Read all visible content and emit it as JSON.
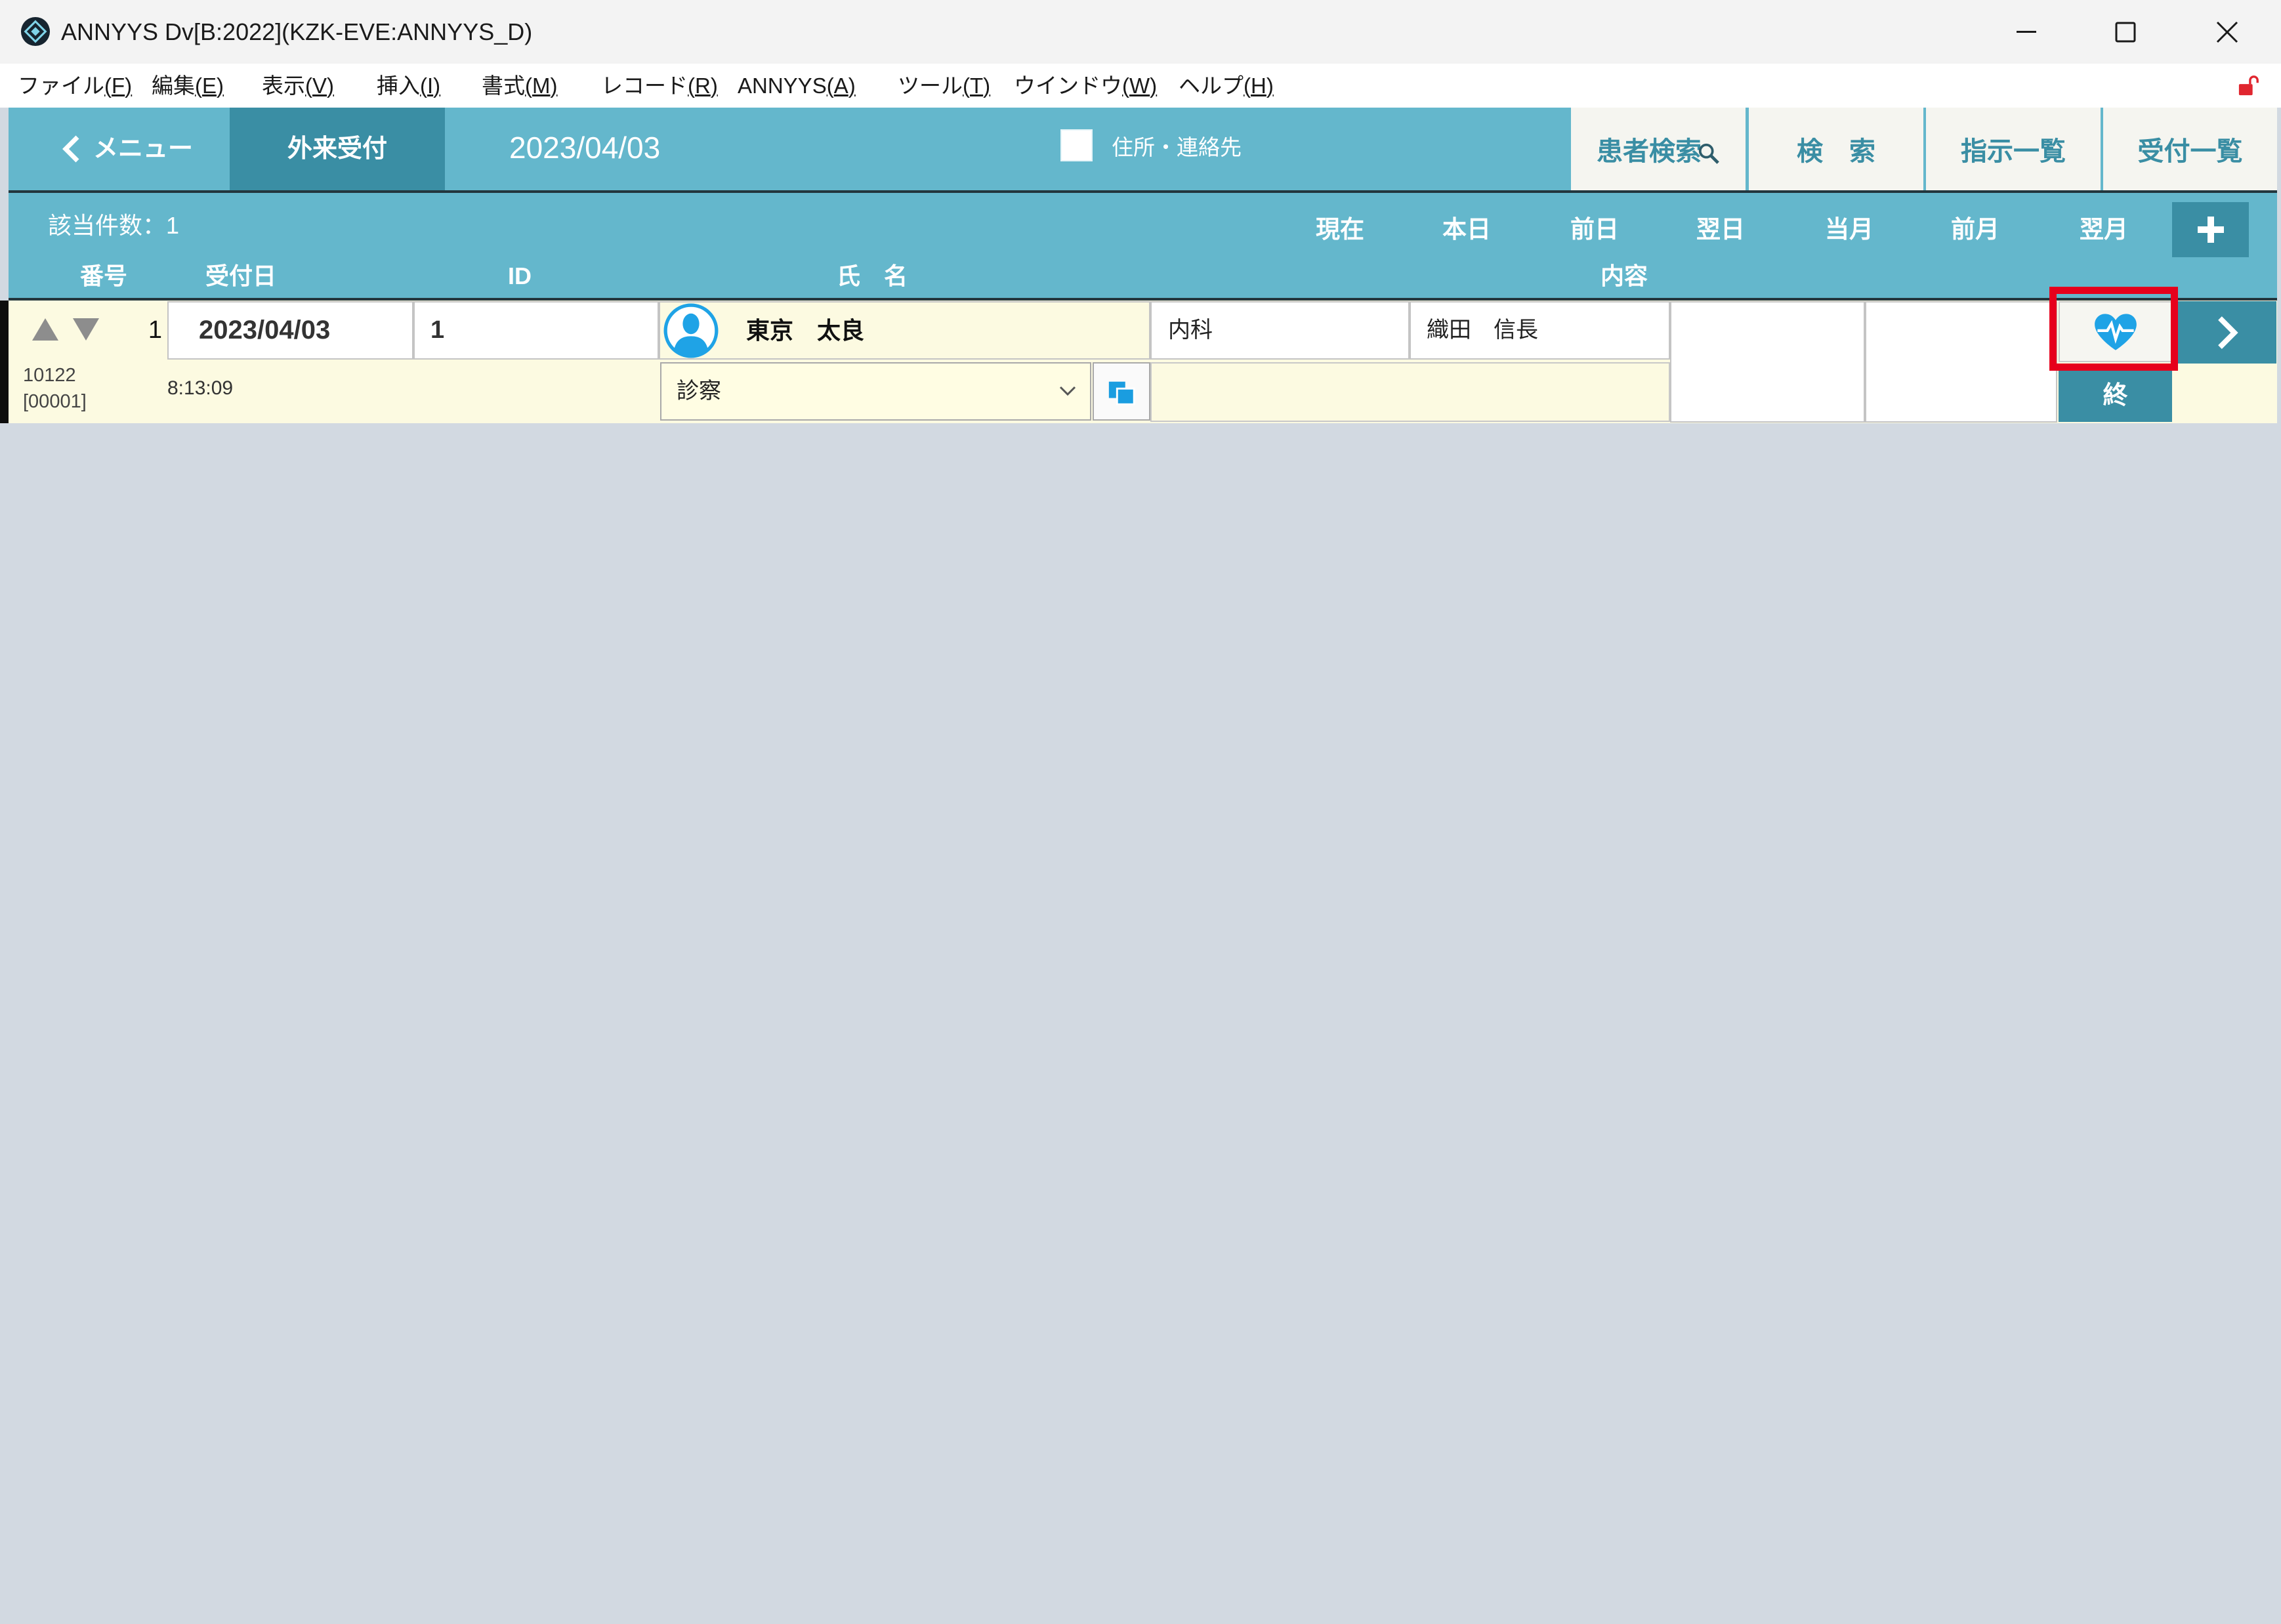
{
  "window": {
    "title": "ANNYYS Dv[B:2022](KZK-EVE:ANNYYS_D)"
  },
  "menu": [
    {
      "label": "ファイル",
      "key": "F"
    },
    {
      "label": "編集",
      "key": "E"
    },
    {
      "label": "表示",
      "key": "V"
    },
    {
      "label": "挿入",
      "key": "I"
    },
    {
      "label": "書式",
      "key": "M"
    },
    {
      "label": "レコード",
      "key": "R"
    },
    {
      "label": "ANNYYS",
      "key": "A"
    },
    {
      "label": "ツール",
      "key": "T"
    },
    {
      "label": "ウインドウ",
      "key": "W"
    },
    {
      "label": "ヘルプ",
      "key": "H"
    }
  ],
  "toolbar": {
    "back_label": "メニュー",
    "active_tab": "外来受付",
    "date": "2023/04/03",
    "address_option": {
      "label": "住所・連絡先",
      "checked": false
    },
    "buttons": [
      {
        "label": "患者検索"
      },
      {
        "label": "検　索"
      },
      {
        "label": "指示一覧"
      },
      {
        "label": "受付一覧"
      }
    ]
  },
  "filter": {
    "count_label": "該当件数：",
    "count": "1",
    "periods": [
      "現在",
      "本日",
      "前日",
      "翌日",
      "当月",
      "前月",
      "翌月"
    ]
  },
  "columns": [
    "番号",
    "受付日",
    "ID",
    "氏　名",
    "内容"
  ],
  "rows": [
    {
      "number": "1",
      "reception_no": "10122",
      "reception_sub_no": "[00001]",
      "date": "2023/04/03",
      "time": "8:13:09",
      "patient_id": "1",
      "name": "東京　太良",
      "department": "内科",
      "doctor": "織田　信長",
      "visit_type": "診察",
      "status": "終"
    }
  ],
  "icons": {
    "app": "app-logo-icon",
    "minimize": "minimize-icon",
    "maximize": "maximize-icon",
    "close": "close-icon",
    "lock": "unlock-icon",
    "back": "chevron-left-icon",
    "search": "search-icon",
    "add": "plus-icon",
    "sort_up": "triangle-up-icon",
    "sort_down": "triangle-down-icon",
    "avatar": "user-avatar-icon",
    "dropdown": "chevron-down-icon",
    "copy": "copy-icon",
    "vitals": "heart-pulse-icon",
    "next": "chevron-right-icon"
  },
  "colors": {
    "accent": "#64b7cc",
    "accent_dark": "#3a8ea4",
    "row_background": "#fcfae1",
    "workspace": "#d2d9e1",
    "highlight": "#e6001c",
    "icon_blue": "#1fa3e6"
  }
}
